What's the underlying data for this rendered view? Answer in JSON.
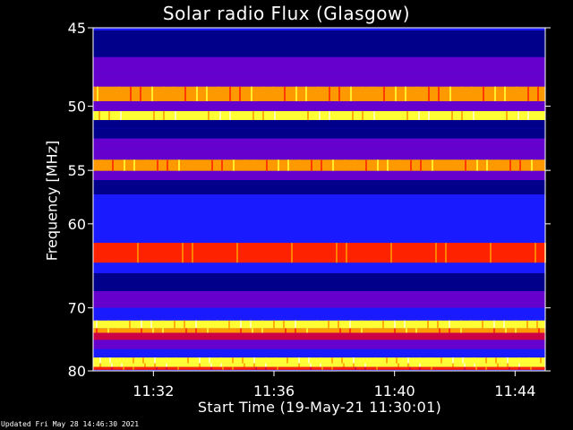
{
  "title": "Solar radio Flux (Glasgow)",
  "footer_text": "Updated Fri May 28 14:46:30 2021",
  "chart_data": {
    "type": "heatmap",
    "title": "Solar radio Flux (Glasgow)",
    "xlabel": "Start Time (19-May-21 11:30:01)",
    "ylabel": "Frequency [MHz]",
    "x_ticks": [
      "11:32",
      "11:36",
      "11:40",
      "11:44"
    ],
    "x_tick_minutes": [
      2,
      6,
      10,
      14
    ],
    "x_range_minutes": [
      0,
      15
    ],
    "y_ticks": [
      45,
      50,
      55,
      60,
      70,
      80
    ],
    "y_range": [
      45,
      80
    ],
    "y_scale": "reciprocal",
    "colormap": [
      "#00008b",
      "#1a1aff",
      "#6600cc",
      "#cc0044",
      "#ff2200",
      "#ff9900",
      "#ffff33",
      "#ffffcc"
    ],
    "background_color": "#1a1aff",
    "bands": [
      {
        "freq": 45.3,
        "level": 0.02
      },
      {
        "freq": 46.0,
        "level": 0.0
      },
      {
        "freq": 47.5,
        "level": 0.3
      },
      {
        "freq": 48.0,
        "level": 0.25
      },
      {
        "freq": 49.3,
        "level": 0.7
      },
      {
        "freq": 50.0,
        "level": 0.35
      },
      {
        "freq": 50.7,
        "level": 0.85
      },
      {
        "freq": 51.3,
        "level": 0.05
      },
      {
        "freq": 52.0,
        "level": 0.0
      },
      {
        "freq": 52.8,
        "level": 0.3
      },
      {
        "freq": 53.5,
        "level": 0.3
      },
      {
        "freq": 54.7,
        "level": 0.75
      },
      {
        "freq": 55.4,
        "level": 0.35
      },
      {
        "freq": 56.3,
        "level": 0.0
      },
      {
        "freq": 58.0,
        "level": 0.2
      },
      {
        "freq": 60.0,
        "level": 0.15
      },
      {
        "freq": 64.0,
        "level": 0.62
      },
      {
        "freq": 64.5,
        "level": 0.08
      },
      {
        "freq": 66.5,
        "level": 0.05
      },
      {
        "freq": 69.0,
        "level": 0.22
      },
      {
        "freq": 71.0,
        "level": 0.2
      },
      {
        "freq": 72.6,
        "level": 0.88
      },
      {
        "freq": 73.3,
        "level": 0.72
      },
      {
        "freq": 74.0,
        "level": 0.45
      },
      {
        "freq": 75.5,
        "level": 0.25
      },
      {
        "freq": 77.0,
        "level": 0.15
      },
      {
        "freq": 78.3,
        "level": 0.82
      },
      {
        "freq": 79.0,
        "level": 0.86
      },
      {
        "freq": 79.6,
        "level": 0.55
      }
    ]
  }
}
